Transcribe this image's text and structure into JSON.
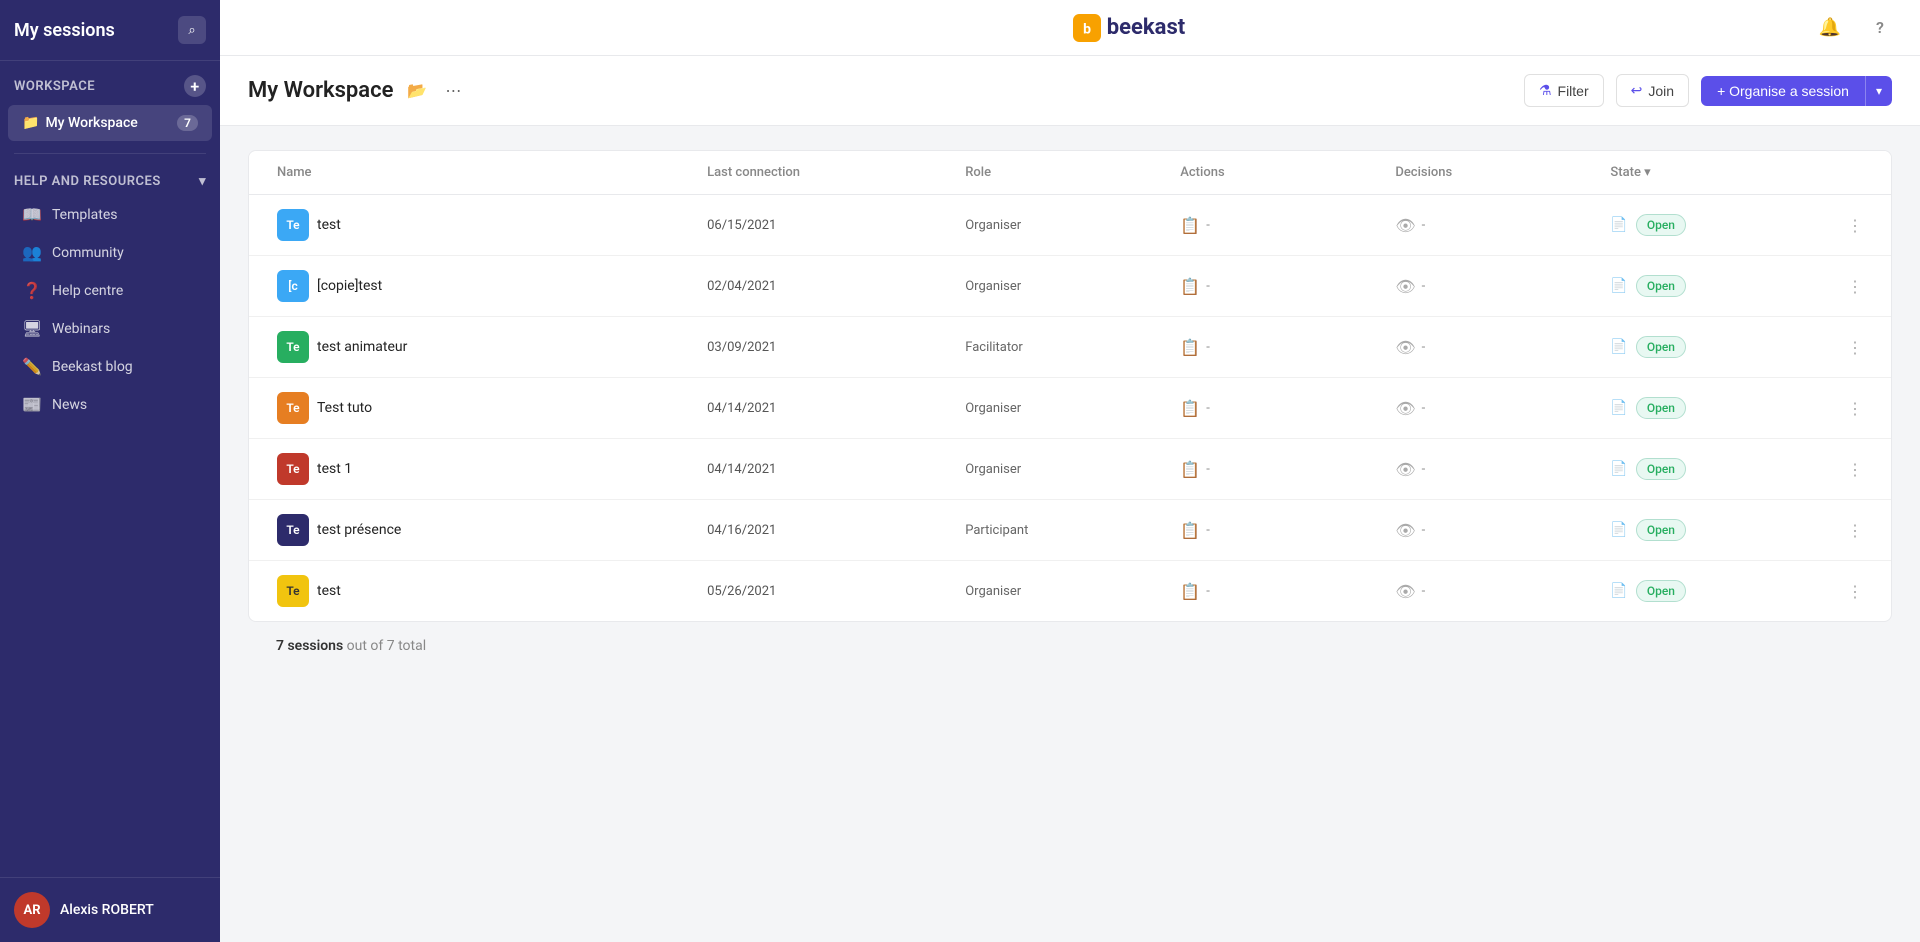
{
  "sidebar": {
    "header": {
      "title": "My sessions",
      "search_btn": "⌕"
    },
    "workspace_section": {
      "label": "Workspace",
      "plus": "+"
    },
    "my_workspace": {
      "label": "My Workspace",
      "count": "7",
      "icon": "📁"
    },
    "resources_section": {
      "label": "Help and resources",
      "caret": "▾"
    },
    "nav_items": [
      {
        "id": "templates",
        "icon": "📖",
        "label": "Templates"
      },
      {
        "id": "community",
        "icon": "👥",
        "label": "Community"
      },
      {
        "id": "help-centre",
        "icon": "❓",
        "label": "Help centre"
      },
      {
        "id": "webinars",
        "icon": "🖥",
        "label": "Webinars"
      },
      {
        "id": "beekast-blog",
        "icon": "✏️",
        "label": "Beekast blog"
      },
      {
        "id": "news",
        "icon": "📰",
        "label": "News"
      }
    ],
    "user": {
      "initials": "AR",
      "name": "Alexis ROBERT"
    }
  },
  "topbar": {
    "logo_text": "beekast",
    "notification_icon": "🔔",
    "help_icon": "?"
  },
  "workspace_header": {
    "title": "My Workspace",
    "folder_icon": "📂",
    "more_icon": "⋯",
    "filter_btn": "Filter",
    "join_btn": "Join",
    "organise_btn": "+ Organise a session",
    "caret": "▾"
  },
  "table": {
    "columns": [
      "Name",
      "Last connection",
      "Role",
      "Actions",
      "Decisions",
      "State"
    ],
    "rows": [
      {
        "initials": "Te",
        "color": "#3ba8f5",
        "name": "test",
        "date": "06/15/2021",
        "role": "Organiser",
        "actions": "-",
        "decisions": "-",
        "state": "Open"
      },
      {
        "initials": "[c",
        "color": "#3ba8f5",
        "name": "[copie]test",
        "date": "02/04/2021",
        "role": "Organiser",
        "actions": "-",
        "decisions": "-",
        "state": "Open"
      },
      {
        "initials": "Te",
        "color": "#27ae60",
        "name": "test animateur",
        "date": "03/09/2021",
        "role": "Facilitator",
        "actions": "-",
        "decisions": "-",
        "state": "Open"
      },
      {
        "initials": "Te",
        "color": "#e67e22",
        "name": "Test tuto",
        "date": "04/14/2021",
        "role": "Organiser",
        "actions": "-",
        "decisions": "-",
        "state": "Open"
      },
      {
        "initials": "Te",
        "color": "#c0392b",
        "name": "test 1",
        "date": "04/14/2021",
        "role": "Organiser",
        "actions": "-",
        "decisions": "-",
        "state": "Open"
      },
      {
        "initials": "Te",
        "color": "#2d2b6b",
        "name": "test présence",
        "date": "04/16/2021",
        "role": "Participant",
        "actions": "-",
        "decisions": "-",
        "state": "Open"
      },
      {
        "initials": "Te",
        "color": "#f1c40f",
        "name": "test",
        "date": "05/26/2021",
        "role": "Organiser",
        "actions": "-",
        "decisions": "-",
        "state": "Open"
      }
    ]
  },
  "footer": {
    "sessions_count": "7 sessions",
    "sessions_total": " out of 7 total"
  }
}
